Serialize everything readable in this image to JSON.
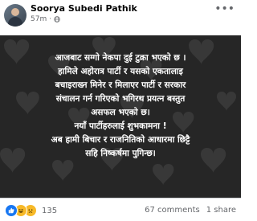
{
  "post": {
    "author": "Soorya Subedi Pathik",
    "time": "57m",
    "visibility_icon": "globe-icon",
    "more_icon": "more-options-icon",
    "background_color": "#262626",
    "text_color": "#ffffff",
    "lines": [
      "आजबाट सग्गो नेकपा दुई टुक्रा भएको छ ।",
      "हामिले अहोरात्र पार्टी र यसको एकतालाइ",
      "बचाइराख्न मिनेर र मिलाएर पार्टी र सरकार",
      "संचालन गर्न गरिएको भगिरथ प्रयत्न बस्तुत",
      "असफल भएको छ।",
      "नयाँ पार्टीहरुलाई शुभकामना !",
      "अब हामी बिचार र राजनितिको आधारमा छिट्टै",
      "सहि निष्कर्षमा पुगिन्छ।"
    ]
  },
  "footer": {
    "reactions": [
      "like-icon",
      "haha-icon",
      "sad-icon"
    ],
    "reaction_count": "135",
    "comments": "67 comments",
    "shares": "1 share"
  }
}
